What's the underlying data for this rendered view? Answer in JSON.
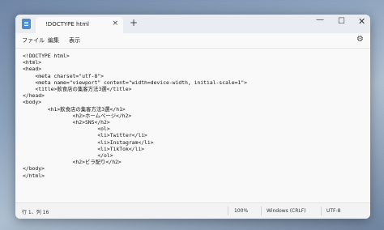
{
  "tab": {
    "title": "!DOCTYPE html",
    "close_glyph": "×",
    "new_glyph": "+"
  },
  "window_controls": {
    "minimize": "—",
    "maximize": "☐",
    "close": "✕"
  },
  "menu": [
    "ファイル",
    "編集",
    "表示"
  ],
  "editor": {
    "lines": [
      "<!DOCTYPE html>",
      "<html>",
      "<head>",
      "    <meta charset=\"utf-8\">",
      "    <meta name=\"viewport\" content=\"width=device-width, initial-scale=1\">",
      "    <title>飲食店の集客方法3選</title>",
      "</head>",
      "<body>",
      "        <h1>飲食店の集客方法3選</h1>",
      "                <h2>ホームページ</h2>",
      "                <h2>SNS</h2>",
      "                        <ol>",
      "                        <li>Twitter</li>",
      "                        <li>Instagram</li>",
      "                        <li>TikTok</li>",
      "                        </ol>",
      "                <h2>ビラ配り</h2>",
      "</body>",
      "</html>"
    ]
  },
  "status": {
    "position": "行 1、列 16",
    "zoom": "100%",
    "line_ending": "Windows (CRLF)",
    "encoding": "UTF-8"
  }
}
